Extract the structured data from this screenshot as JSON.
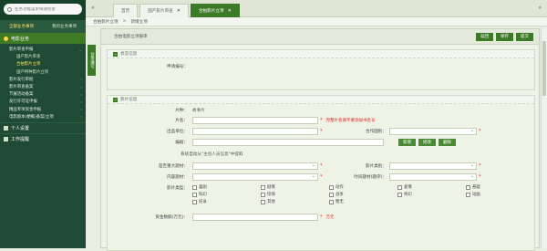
{
  "sidebar": {
    "search_placeholder": "业务功能菜单快速检索",
    "tabs": [
      "全部业务事项",
      "我的业务事项"
    ],
    "group_title": "电影业务",
    "items": [
      {
        "label": "影片审查申报",
        "sub": false,
        "active": false
      },
      {
        "label": "国产影片审查",
        "sub": true,
        "active": false
      },
      {
        "label": "合拍影片立项",
        "sub": true,
        "active": true
      },
      {
        "label": "国产特种影片立项",
        "sub": true,
        "active": false
      },
      {
        "label": "影片发行审批",
        "sub": false,
        "active": false
      },
      {
        "label": "影片审查备案",
        "sub": false,
        "active": false
      },
      {
        "label": "节展活动备案",
        "sub": false,
        "active": false
      },
      {
        "label": "发行许可证申报",
        "sub": false,
        "active": false
      },
      {
        "label": "精品专项资金申报",
        "sub": false,
        "active": false
      },
      {
        "label": "电影剧本(梗概)备案/立项",
        "sub": false,
        "active": false
      }
    ],
    "sections": [
      "个人设置",
      "工作提醒"
    ]
  },
  "topbar": {
    "tabs": [
      {
        "label": "首页",
        "closable": false,
        "active": false
      },
      {
        "label": "国产影片审查",
        "closable": true,
        "active": false
      },
      {
        "label": "合拍影片立项",
        "closable": true,
        "active": true
      }
    ]
  },
  "breadcrumb": [
    "合拍影片立项",
    ">",
    "新增立项"
  ],
  "side_label": "业务填写",
  "main": {
    "title": "合拍电影立项报审",
    "buttons": [
      "返回",
      "保存",
      "提交"
    ],
    "section1": {
      "title": "状态信息",
      "apply_no_label": "申请编号："
    },
    "section2": {
      "title": "影片信息",
      "category_label": "片种：",
      "category_value": "故事片",
      "name_label": "片名：",
      "name_warning": "完整片名请不要添加书名号",
      "producer_label": "出品单位：",
      "coop_label": "合作国别：",
      "screenwriter_label": "编剧：",
      "action_buttons": [
        "新增",
        "修改",
        "删除"
      ],
      "note": "系统自动从\"主创人员信息\"中提取",
      "theme_label": "是否重大题材：",
      "genre_label": "影片类别：",
      "content_label": "内容题材：",
      "era_label": "时间题材(题序)：",
      "type_label": "影片类型：",
      "types": [
        "喜剧",
        "剧情",
        "动作",
        "爱情",
        "悬疑",
        "科幻",
        "惊悚",
        "战争",
        "奇幻",
        "动画",
        "纪录",
        "其他",
        "暂无"
      ],
      "budget_label": "资金数额(万元)：",
      "budget_unit": "万元"
    }
  }
}
